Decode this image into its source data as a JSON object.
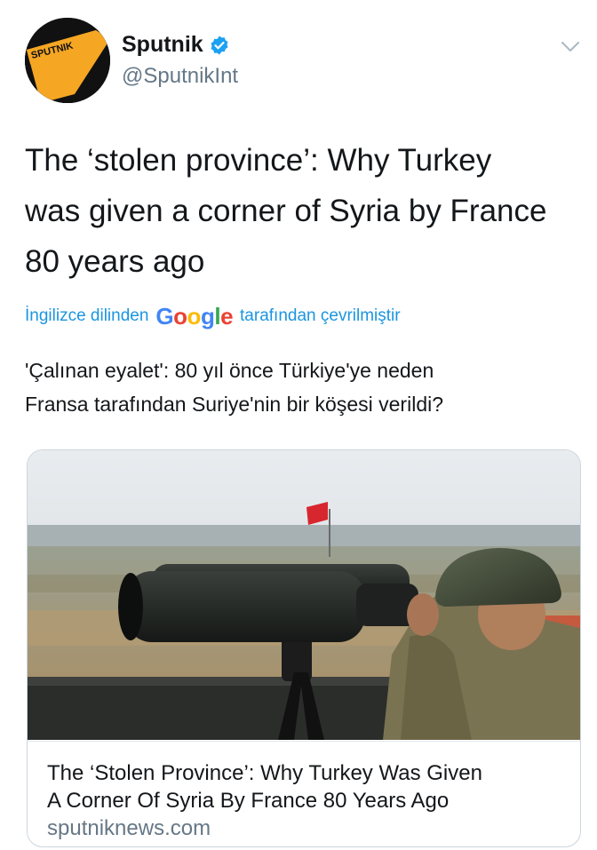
{
  "author": {
    "display_name": "Sputnik",
    "handle": "@SputnikInt",
    "avatar_text": "SPUTNIK",
    "verified": true,
    "verified_icon": "verified-badge-icon"
  },
  "tweet": {
    "text_lines": [
      "The ‘stolen province’: Why Turkey",
      "was given a corner of Syria by France",
      "80 years ago"
    ]
  },
  "translation": {
    "prefix": "İngilizce dilinden",
    "provider": "Google",
    "suffix": "tarafından çevrilmiştir",
    "translated_lines": [
      "'Çalınan eyalet': 80 yıl önce Türkiye'ye neden",
      "Fransa tarafından Suriye'nin bir köşesi verildi?"
    ]
  },
  "card": {
    "image_alt": "soldier-with-binoculars-photo",
    "title_lines": [
      "The ‘Stolen Province’: Why Turkey Was Given",
      "A Corner Of Syria By France 80 Years Ago"
    ],
    "domain": "sputniknews.com"
  },
  "colors": {
    "link_blue": "#1b95e0",
    "verified_blue": "#1da1f2",
    "secondary_text": "#657786",
    "brand_orange": "#f5a623"
  }
}
